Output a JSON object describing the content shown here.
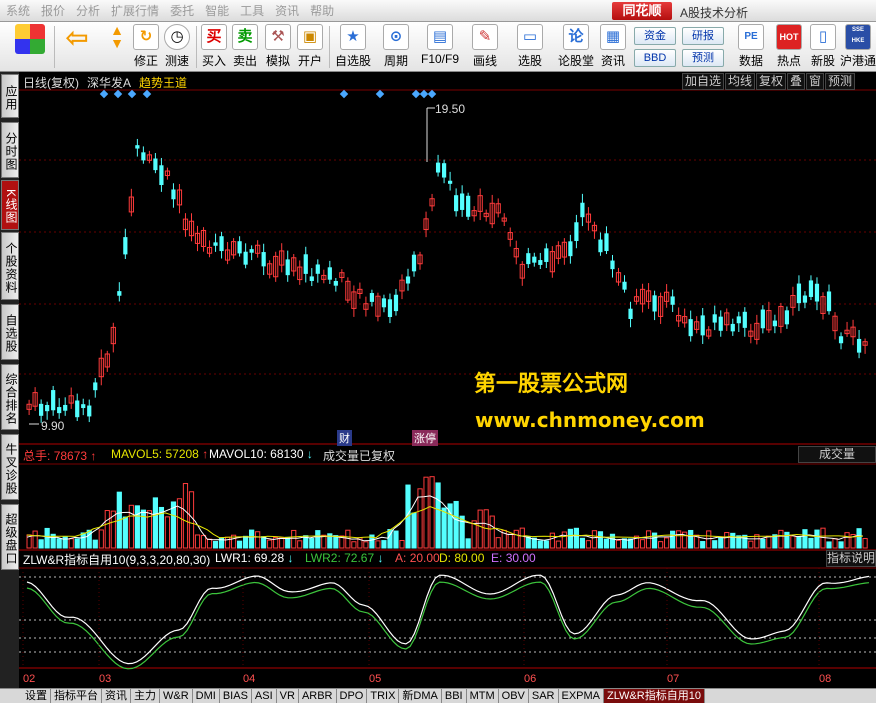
{
  "menu": {
    "items": [
      "系统",
      "报价",
      "分析",
      "扩展行情",
      "委托",
      "智能",
      "工具",
      "资讯",
      "帮助"
    ]
  },
  "brand": {
    "logo": "同花顺",
    "title": "A股技术分析"
  },
  "toolbar": {
    "buttons": [
      {
        "label": "应用",
        "icon": "grid-icon"
      },
      {
        "label": "修正",
        "icon": "refresh-icon"
      },
      {
        "label": "测速",
        "icon": "clock-icon"
      },
      {
        "label": "买入",
        "icon": "buy-icon",
        "glyph": "买"
      },
      {
        "label": "卖出",
        "icon": "sell-icon",
        "glyph": "卖"
      },
      {
        "label": "模拟",
        "icon": "hammer-icon"
      },
      {
        "label": "开户",
        "icon": "lock-icon"
      },
      {
        "label": "自选股",
        "icon": "star-icon"
      },
      {
        "label": "周期",
        "icon": "period-icon"
      },
      {
        "label": "F10/F9",
        "icon": "f10-icon"
      },
      {
        "label": "画线",
        "icon": "pen-icon"
      },
      {
        "label": "选股",
        "icon": "monitor-icon"
      },
      {
        "label": "论股堂",
        "icon": "discuss-icon",
        "glyph": "论"
      },
      {
        "label": "资讯",
        "icon": "doc-icon"
      },
      {
        "label": "数据",
        "icon": "pe-icon",
        "glyph": "PE"
      },
      {
        "label": "热点",
        "icon": "hot-icon",
        "glyph": "HOT"
      },
      {
        "label": "新股",
        "icon": "newstock-icon"
      },
      {
        "label": "沪港通",
        "icon": "hk-icon",
        "glyph": "SSE HKE"
      }
    ],
    "small_buttons": [
      "资金",
      "研报",
      "BBD",
      "预测"
    ]
  },
  "leftnav": {
    "tabs": [
      "应用",
      "分时图",
      "K线图",
      "个股资料",
      "自选股",
      "综合排名",
      "牛叉诊股",
      "超级盘口"
    ],
    "active": "K线图"
  },
  "kline": {
    "period_label": "日线(复权)",
    "stock_name": "深华发A",
    "indicator_name": "趋势王道",
    "right_buttons": [
      "加自选",
      "均线",
      "复权",
      "叠",
      "窗",
      "预测"
    ],
    "high_price": "19.50",
    "low_price": "9.90",
    "event_labels": [
      "财",
      "涨停"
    ]
  },
  "volume": {
    "total_label": "总手",
    "total_value": "78673",
    "mavol5_label": "MAVOL5",
    "mavol5_value": "57208",
    "mavol10_label": "MAVOL10",
    "mavol10_value": "68130",
    "note": "成交量已复权",
    "right_button": "成交量"
  },
  "indicator": {
    "name": "ZLW&R指标自用10(9,3,3,20,80,30)",
    "lwr1_label": "LWR1",
    "lwr1_value": "69.28",
    "lwr2_label": "LWR2",
    "lwr2_value": "72.67",
    "a_label": "A",
    "a_value": "20.00",
    "d_label": "D",
    "d_value": "80.00",
    "e_label": "E",
    "e_value": "30.00",
    "right_button": "指标说明"
  },
  "xaxis": {
    "months": [
      "02",
      "03",
      "04",
      "05",
      "06",
      "07",
      "08"
    ]
  },
  "watermark": {
    "line1": "第一股票公式网",
    "line2": "www.chnmoney.com"
  },
  "bottom_tabs": [
    "设置",
    "指标平台",
    "资讯",
    "主力",
    "W&R",
    "DMI",
    "BIAS",
    "ASI",
    "VR",
    "ARBR",
    "DPO",
    "TRIX",
    "新DMA",
    "BBI",
    "MTM",
    "OBV",
    "SAR",
    "EXPMA",
    "ZLW&R指标自用10"
  ],
  "colors": {
    "up": "#ff3b3b",
    "down": "#54ffff",
    "ma5": "#ffffff",
    "ma10": "#e5e500",
    "lwr1": "#ffffff",
    "lwr2": "#3cc43c",
    "accent": "#ffd400"
  }
}
